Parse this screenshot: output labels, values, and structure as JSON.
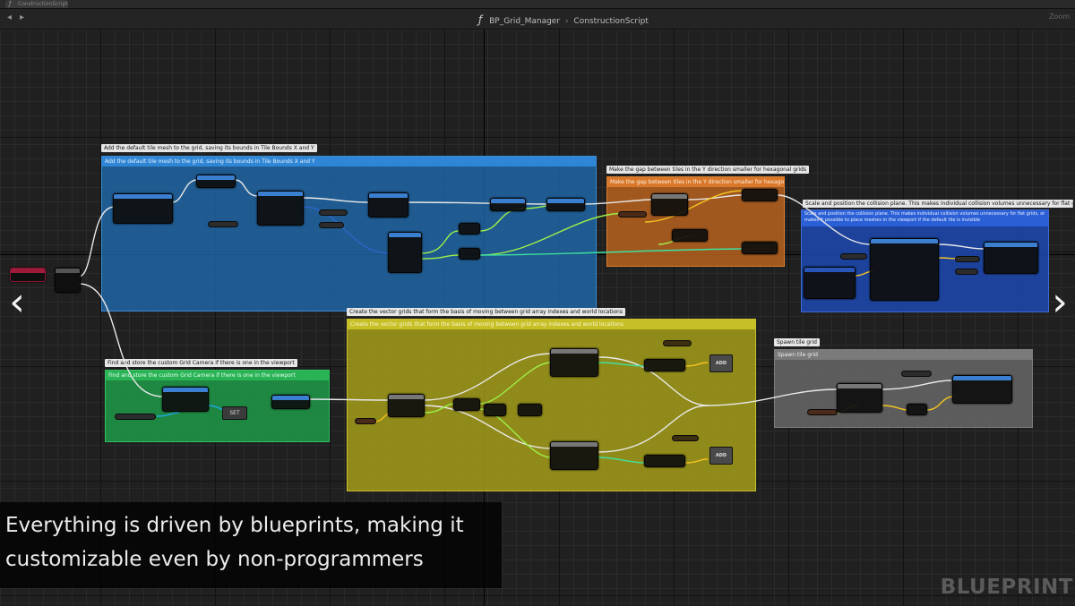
{
  "tab": {
    "title": "ConstructionScript",
    "icon": "function-icon"
  },
  "breadcrumb": {
    "blueprint": "BP_Grid_Manager",
    "graph": "ConstructionScript"
  },
  "toolbar": {
    "zoom": "Zoom"
  },
  "comments": [
    {
      "bubble": "Add the default tile mesh to the grid, saving its bounds in Tile Bounds X and Y",
      "header": "Add the default tile mesh to the grid, saving its bounds in Tile Bounds X and Y",
      "color": "#1f6cb0"
    },
    {
      "bubble": "Make the gap between tiles in the Y direction smaller for hexagonal grids",
      "header": "Make the gap between tiles in the Y direction smaller for hexagonal grids",
      "color": "#c2661e"
    },
    {
      "bubble": "Scale and position the collision plane. This makes individual collision volumes unnecessary for flat grids, and makes",
      "header": "Scale and position the collision plane. This makes individual collision volumes unnecessary for flat grids, or makes it possible to place meshes in the viewport if the default tile is invisible",
      "color": "#1c4ab8"
    },
    {
      "bubble": "Create the vector grids that form the basis of moving between grid array indexes and world locations",
      "header": "Create the vector grids that form the basis of moving between grid array indexes and world locations",
      "color": "#a9a21a"
    },
    {
      "bubble": "Find and store the custom Grid Camera if there is one in the viewport",
      "header": "Find and store the custom Grid Camera if there is one in the viewport",
      "color": "#1e9a49"
    },
    {
      "bubble": "Spawn tile grid",
      "header": "Spawn tile grid",
      "color": "#6a6a6a"
    }
  ],
  "nodes": {
    "set_label": "SET",
    "add_label": "ADD"
  },
  "caption": {
    "line1": "Everything is driven by blueprints, making it",
    "line2": "customizable even by non-programmers"
  },
  "watermark": "BLUEPRINT",
  "colors": {
    "exec_wire": "#e8e8e8",
    "vector_wire": "#f3c321",
    "struct_wire": "#2e64c8",
    "float_wire": "#9ef04a",
    "object_wire": "#1ea8e8",
    "int_wire": "#3fe0a0"
  }
}
